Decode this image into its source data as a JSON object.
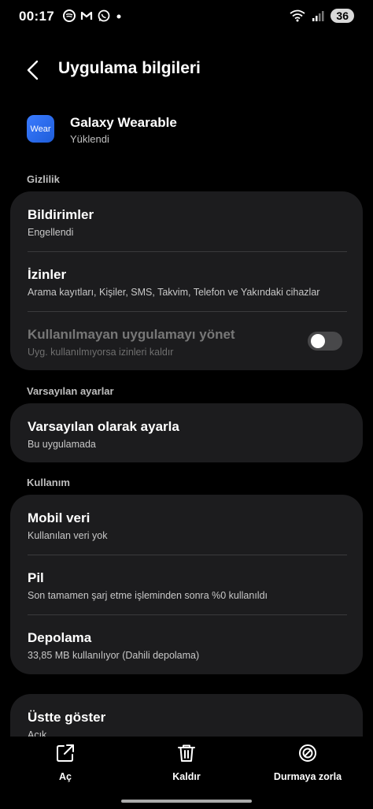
{
  "status_bar": {
    "time": "00:17",
    "notif_icons": [
      "spotify-icon",
      "gmail-icon",
      "whatsapp-icon",
      "dot-icon"
    ],
    "battery": "36"
  },
  "app_bar": {
    "title": "Uygulama bilgileri"
  },
  "app": {
    "icon_text": "Wear",
    "name": "Galaxy Wearable",
    "state": "Yüklendi"
  },
  "sections": {
    "privacy": {
      "label": "Gizlilik",
      "items": [
        {
          "title": "Bildirimler",
          "subtitle": "Engellendi"
        },
        {
          "title": "İzinler",
          "subtitle": "Arama kayıtları, Kişiler, SMS, Takvim, Telefon ve Yakındaki cihazlar"
        },
        {
          "title": "Kullanılmayan uygulamayı yönet",
          "subtitle": "Uyg. kullanılmıyorsa izinleri kaldır",
          "toggle_on": false
        }
      ]
    },
    "defaults": {
      "label": "Varsayılan ayarlar",
      "items": [
        {
          "title": "Varsayılan olarak ayarla",
          "subtitle": "Bu uygulamada"
        }
      ]
    },
    "usage": {
      "label": "Kullanım",
      "items": [
        {
          "title": "Mobil veri",
          "subtitle": "Kullanılan veri yok"
        },
        {
          "title": "Pil",
          "subtitle": "Son tamamen şarj etme işleminden sonra %0 kullanıldı"
        },
        {
          "title": "Depolama",
          "subtitle": "33,85 MB kullanılıyor (Dahili depolama)"
        }
      ]
    },
    "overlay": {
      "items": [
        {
          "title": "Üstte göster",
          "subtitle": "Açık"
        }
      ]
    }
  },
  "bottom_actions": {
    "open": "Aç",
    "uninstall": "Kaldır",
    "force_stop": "Durmaya zorla"
  },
  "colors": {
    "background": "#000000",
    "card": "#1c1c1e",
    "divider": "#3a3a3c",
    "app_icon": "#2f6ff0"
  }
}
